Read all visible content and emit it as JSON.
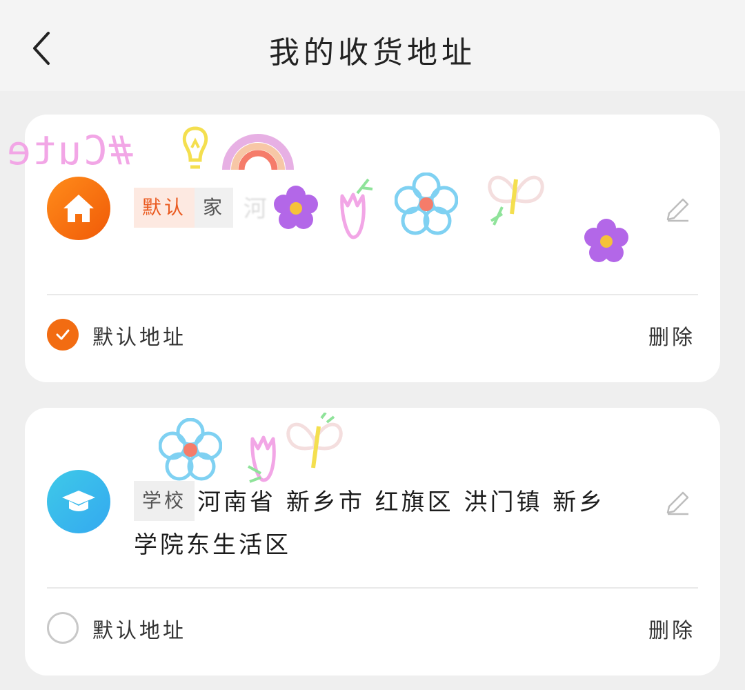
{
  "header": {
    "title": "我的收货地址"
  },
  "addresses": [
    {
      "icon": "home-icon",
      "tags": [
        "默认",
        "家"
      ],
      "address_visible": "河",
      "is_default": true,
      "default_label": "默认地址",
      "delete_label": "删除",
      "accent": "#f26c12"
    },
    {
      "icon": "graduation-cap-icon",
      "tags": [
        "学校"
      ],
      "address_line": "河南省 新乡市 红旗区 洪门镇 新乡学院东生活区",
      "is_default": false,
      "default_label": "默认地址",
      "delete_label": "删除",
      "accent": "#34b3ee"
    }
  ],
  "stickers": {
    "text": "#Cute"
  }
}
